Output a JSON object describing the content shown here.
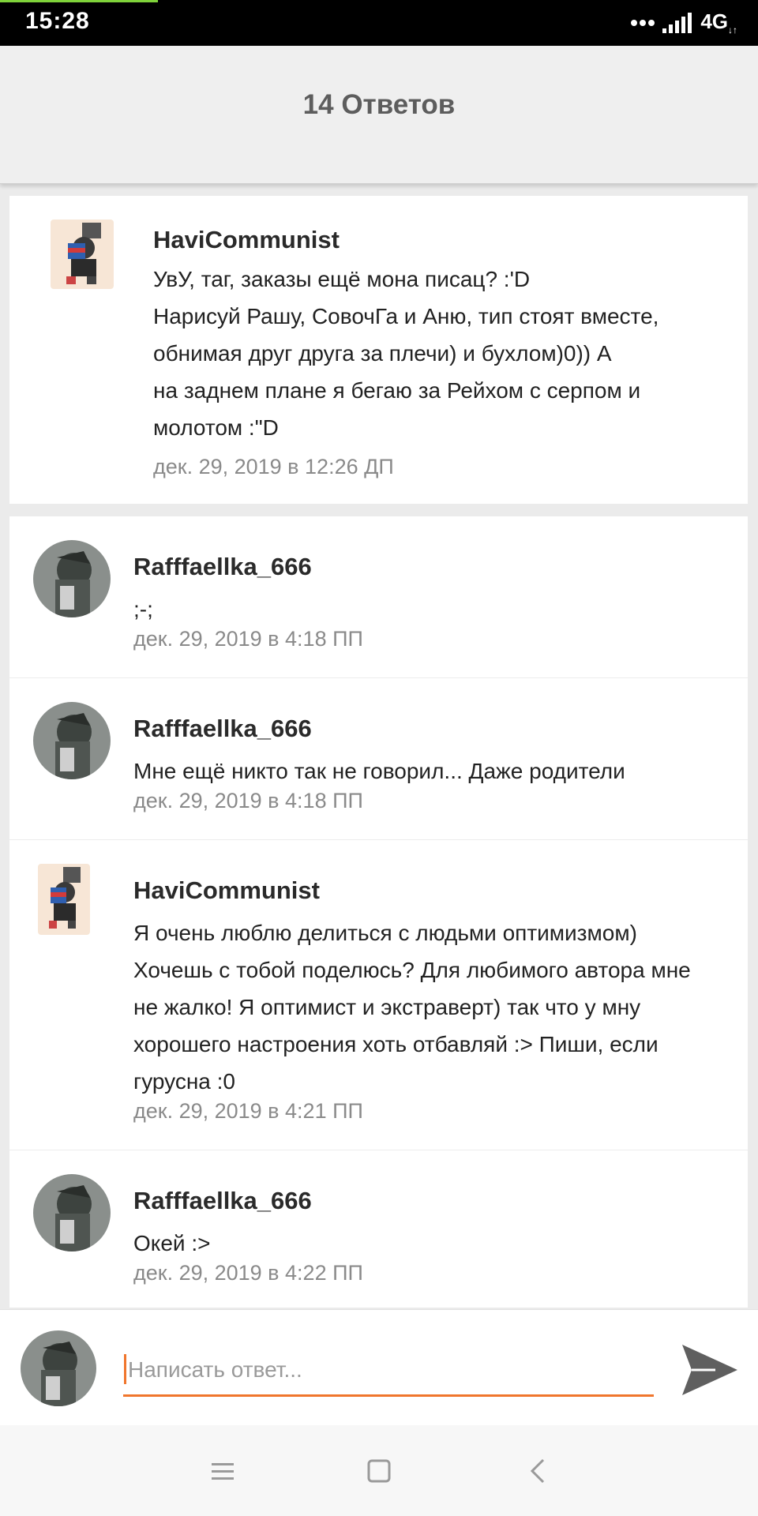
{
  "status_bar": {
    "time": "15:28",
    "network": "4G"
  },
  "header": {
    "title": "14 Ответов"
  },
  "original_post": {
    "author": "HaviCommunist",
    "text": "УвУ, таг, заказы ещё мона писац? :'D\nНарисуй Рашу, СовочГа и Аню, тип стоят вместе,\nобнимая друг друга за плечи) и бухлом)0)) А\nна заднем плане я бегаю за Рейхом с серпом и\nмолотом :\"D",
    "timestamp": "дек. 29, 2019 в 12:26 ДП"
  },
  "replies": [
    {
      "author": "Rafffaellka_666",
      "text": ";-;",
      "timestamp": "дек. 29, 2019 в 4:18 ПП"
    },
    {
      "author": "Rafffaellka_666",
      "text": "Мне ещё никто так не говорил... Даже родители",
      "timestamp": "дек. 29, 2019 в 4:18 ПП"
    },
    {
      "author": "HaviCommunist",
      "text": "Я очень люблю делиться с людьми оптимизмом)\nХочешь с тобой поделюсь? Для любимого автора мне\nне жалко! Я оптимист и экстраверт) так что у мну\nхорошего настроения хоть отбавляй :> Пиши, если\nгурусна :0",
      "timestamp": "дек. 29, 2019 в 4:21 ПП"
    },
    {
      "author": "Rafffaellka_666",
      "text": "Окей :>",
      "timestamp": "дек. 29, 2019 в 4:22 ПП"
    }
  ],
  "composer": {
    "placeholder": "Написать ответ...",
    "value": ""
  },
  "colors": {
    "accent": "#f0762d",
    "header_bg": "#efefef",
    "status_bg": "#000000"
  },
  "icons": {
    "signal": "signal-icon",
    "send": "send-icon",
    "nav_menu": "menu-icon",
    "nav_home": "square-icon",
    "nav_back": "back-icon"
  }
}
